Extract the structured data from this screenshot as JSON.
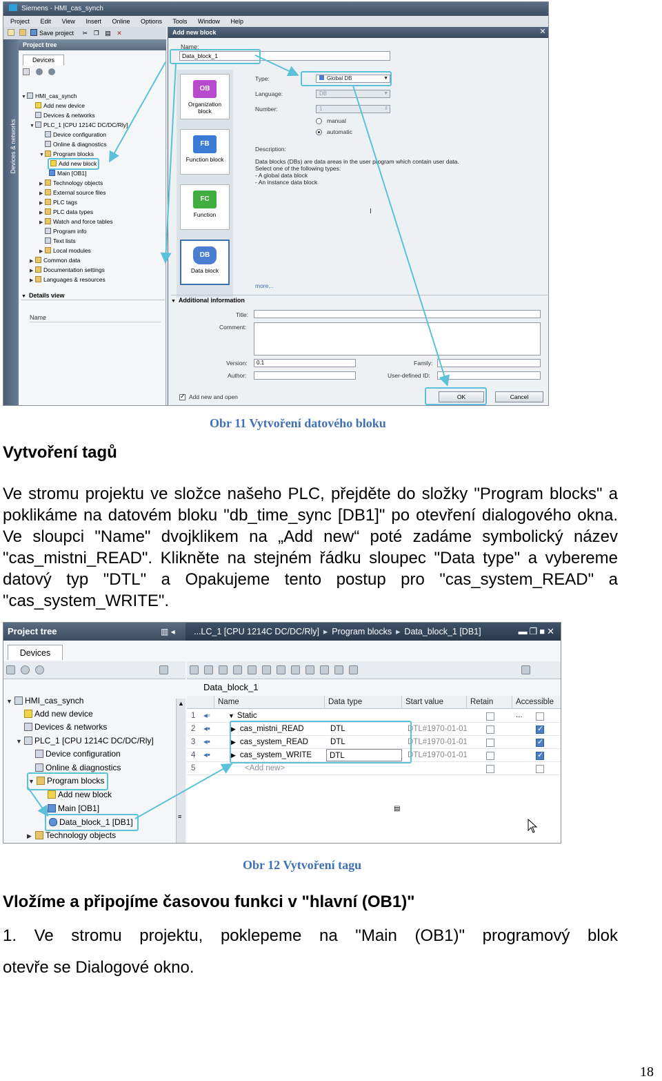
{
  "figure1": {
    "window_title": "Siemens  -  HMI_cas_synch",
    "menu": [
      "Project",
      "Edit",
      "View",
      "Insert",
      "Online",
      "Options",
      "Tools",
      "Window",
      "Help"
    ],
    "save_label": "Save project",
    "vertical_tab": "Devices & networks",
    "project_tree_title": "Project tree",
    "devices_tab": "Devices",
    "tree_items": [
      "HMI_cas_synch",
      "Add new device",
      "Devices & networks",
      "PLC_1 [CPU 1214C DC/DC/Rly]",
      "Device configuration",
      "Online & diagnostics",
      "Program blocks",
      "Add new block",
      "Main [OB1]",
      "Technology objects",
      "External source files",
      "PLC tags",
      "PLC data types",
      "Watch and force tables",
      "Program info",
      "Text lists",
      "Local modules",
      "Common data",
      "Documentation settings",
      "Languages & resources"
    ],
    "details_view": "Details view",
    "details_name": "Name",
    "dialog": {
      "title": "Add new block",
      "name_label": "Name:",
      "name_value": "Data_block_1",
      "blocks": [
        {
          "code": "OB",
          "label": "Organization block"
        },
        {
          "code": "FB",
          "label": "Function block"
        },
        {
          "code": "FC",
          "label": "Function"
        },
        {
          "code": "DB",
          "label": "Data block"
        }
      ],
      "type_label": "Type:",
      "type_value": "Global DB",
      "language_label": "Language:",
      "language_value": "DB",
      "number_label": "Number:",
      "number_value": "1",
      "manual_label": "manual",
      "automatic_label": "automatic",
      "description_label": "Description:",
      "description_lines": [
        "Data blocks (DBs) are data areas in the user program which contain user data.",
        "Select one of the following types:",
        "- A global data block",
        "- An instance data block"
      ],
      "more_label": "more...",
      "additional_info": "Additional information",
      "title_label": "Title:",
      "comment_label": "Comment:",
      "version_label": "Version:",
      "version_value": "0.1",
      "author_label": "Author:",
      "family_label": "Family:",
      "user_id_label": "User-defined ID:",
      "add_new_open": "Add new and open",
      "ok": "OK",
      "cancel": "Cancel"
    }
  },
  "caption1": "Obr 11 Vytvoření datového bloku",
  "heading1": "Vytvoření tagů",
  "paragraph1": "Ve stromu projektu ve složce našeho PLC, přejděte do složky \"Program blocks\" a poklikáme na datovém bloku \"db_time_sync [DB1]\" po otevření dialogového okna. Ve sloupci \"Name\" dvojklikem na „Add new“ poté zadáme symbolický název \"cas_mistni_READ\". Klikněte na stejném řádku sloupec \"Data type\" a vybereme datový typ \"DTL\" a Opakujeme tento postup pro \"cas_system_READ\" a \"cas_system_WRITE\".",
  "figure2": {
    "project_tree_title": "Project tree",
    "breadcrumb": [
      "...LC_1 [CPU 1214C DC/DC/Rly]",
      "Program blocks",
      "Data_block_1 [DB1]"
    ],
    "devices_tab": "Devices",
    "block_title": "Data_block_1",
    "tree_items": [
      "HMI_cas_synch",
      "Add new device",
      "Devices & networks",
      "PLC_1 [CPU 1214C DC/DC/Rly]",
      "Device configuration",
      "Online & diagnostics",
      "Program blocks",
      "Add new block",
      "Main [OB1]",
      "Data_block_1 [DB1]",
      "Technology objects"
    ],
    "columns": [
      "Name",
      "Data type",
      "Start value",
      "Retain",
      "Accessible ..."
    ],
    "rows": [
      {
        "num": "1",
        "name": "Static",
        "type": "",
        "start": "",
        "retain": false,
        "access": false
      },
      {
        "num": "2",
        "name": "cas_mistni_READ",
        "type": "DTL",
        "start": "DTL#1970-01-01-0",
        "retain": false,
        "access": true
      },
      {
        "num": "3",
        "name": "cas_system_READ",
        "type": "DTL",
        "start": "DTL#1970-01-01-0",
        "retain": false,
        "access": true
      },
      {
        "num": "4",
        "name": "cas_system_WRITE",
        "type": "DTL",
        "start": "DTL#1970-01-01-0",
        "retain": false,
        "access": true
      },
      {
        "num": "5",
        "name": "<Add new>",
        "type": "",
        "start": "",
        "retain": false,
        "access": false
      }
    ]
  },
  "caption2": "Obr 12 Vytvoření tagu",
  "heading2": "Vložíme a připojíme časovou funkci v \"hlavní (OB1)\"",
  "paragraph2_line1": "1. Ve stromu projektu, poklepeme na \"Main (OB1)\" programový blok",
  "paragraph2_line2": "otevře se Dialogové okno.",
  "page_number": "18",
  "colors": {
    "caption": "#3f6fb5",
    "highlight": "#5bc0d9"
  }
}
